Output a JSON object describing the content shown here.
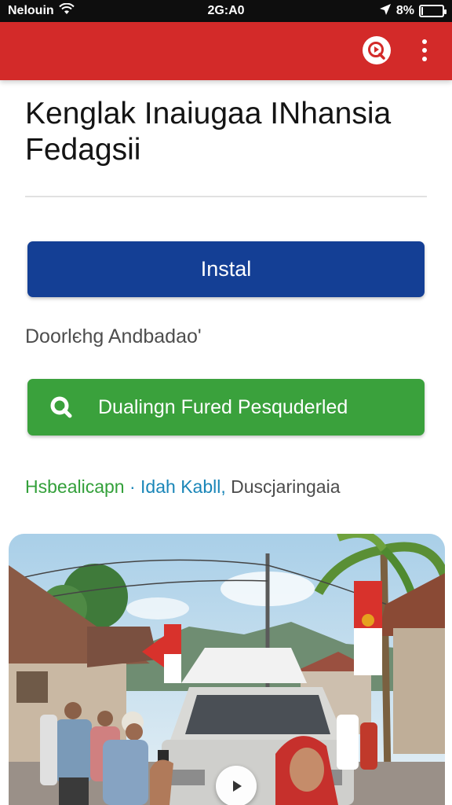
{
  "status_bar": {
    "carrier": "Nelouin",
    "time": "2G:A0",
    "battery": "8%",
    "battery_level": 0.08,
    "icons": [
      "wifi-icon",
      "location-arrow-icon",
      "battery-icon"
    ]
  },
  "app_bar": {
    "color": "#d32a29",
    "actions": [
      "play-store-icon",
      "more-vertical-icon"
    ]
  },
  "page": {
    "title": "Kenglak Inaiugaa INhansia Fedagsii",
    "install_label": "Instal",
    "download_text": "Doorlєhg Andbadao'",
    "secondary_button_label": "Dualingn Fured Pesquderled",
    "secondary_button_icon": "search-icon",
    "tags": {
      "green": "Hsbealicapn",
      "separator": " · ",
      "blue": "Idah Kabll,",
      "grey": " Duscjaringaia"
    }
  },
  "colors": {
    "install": "#143f95",
    "secondary": "#3aa13c",
    "tag_green": "#33a03a",
    "tag_blue": "#1a86b8"
  },
  "media": {
    "image": "village-street-photo",
    "overlay_icon": "play-icon"
  }
}
